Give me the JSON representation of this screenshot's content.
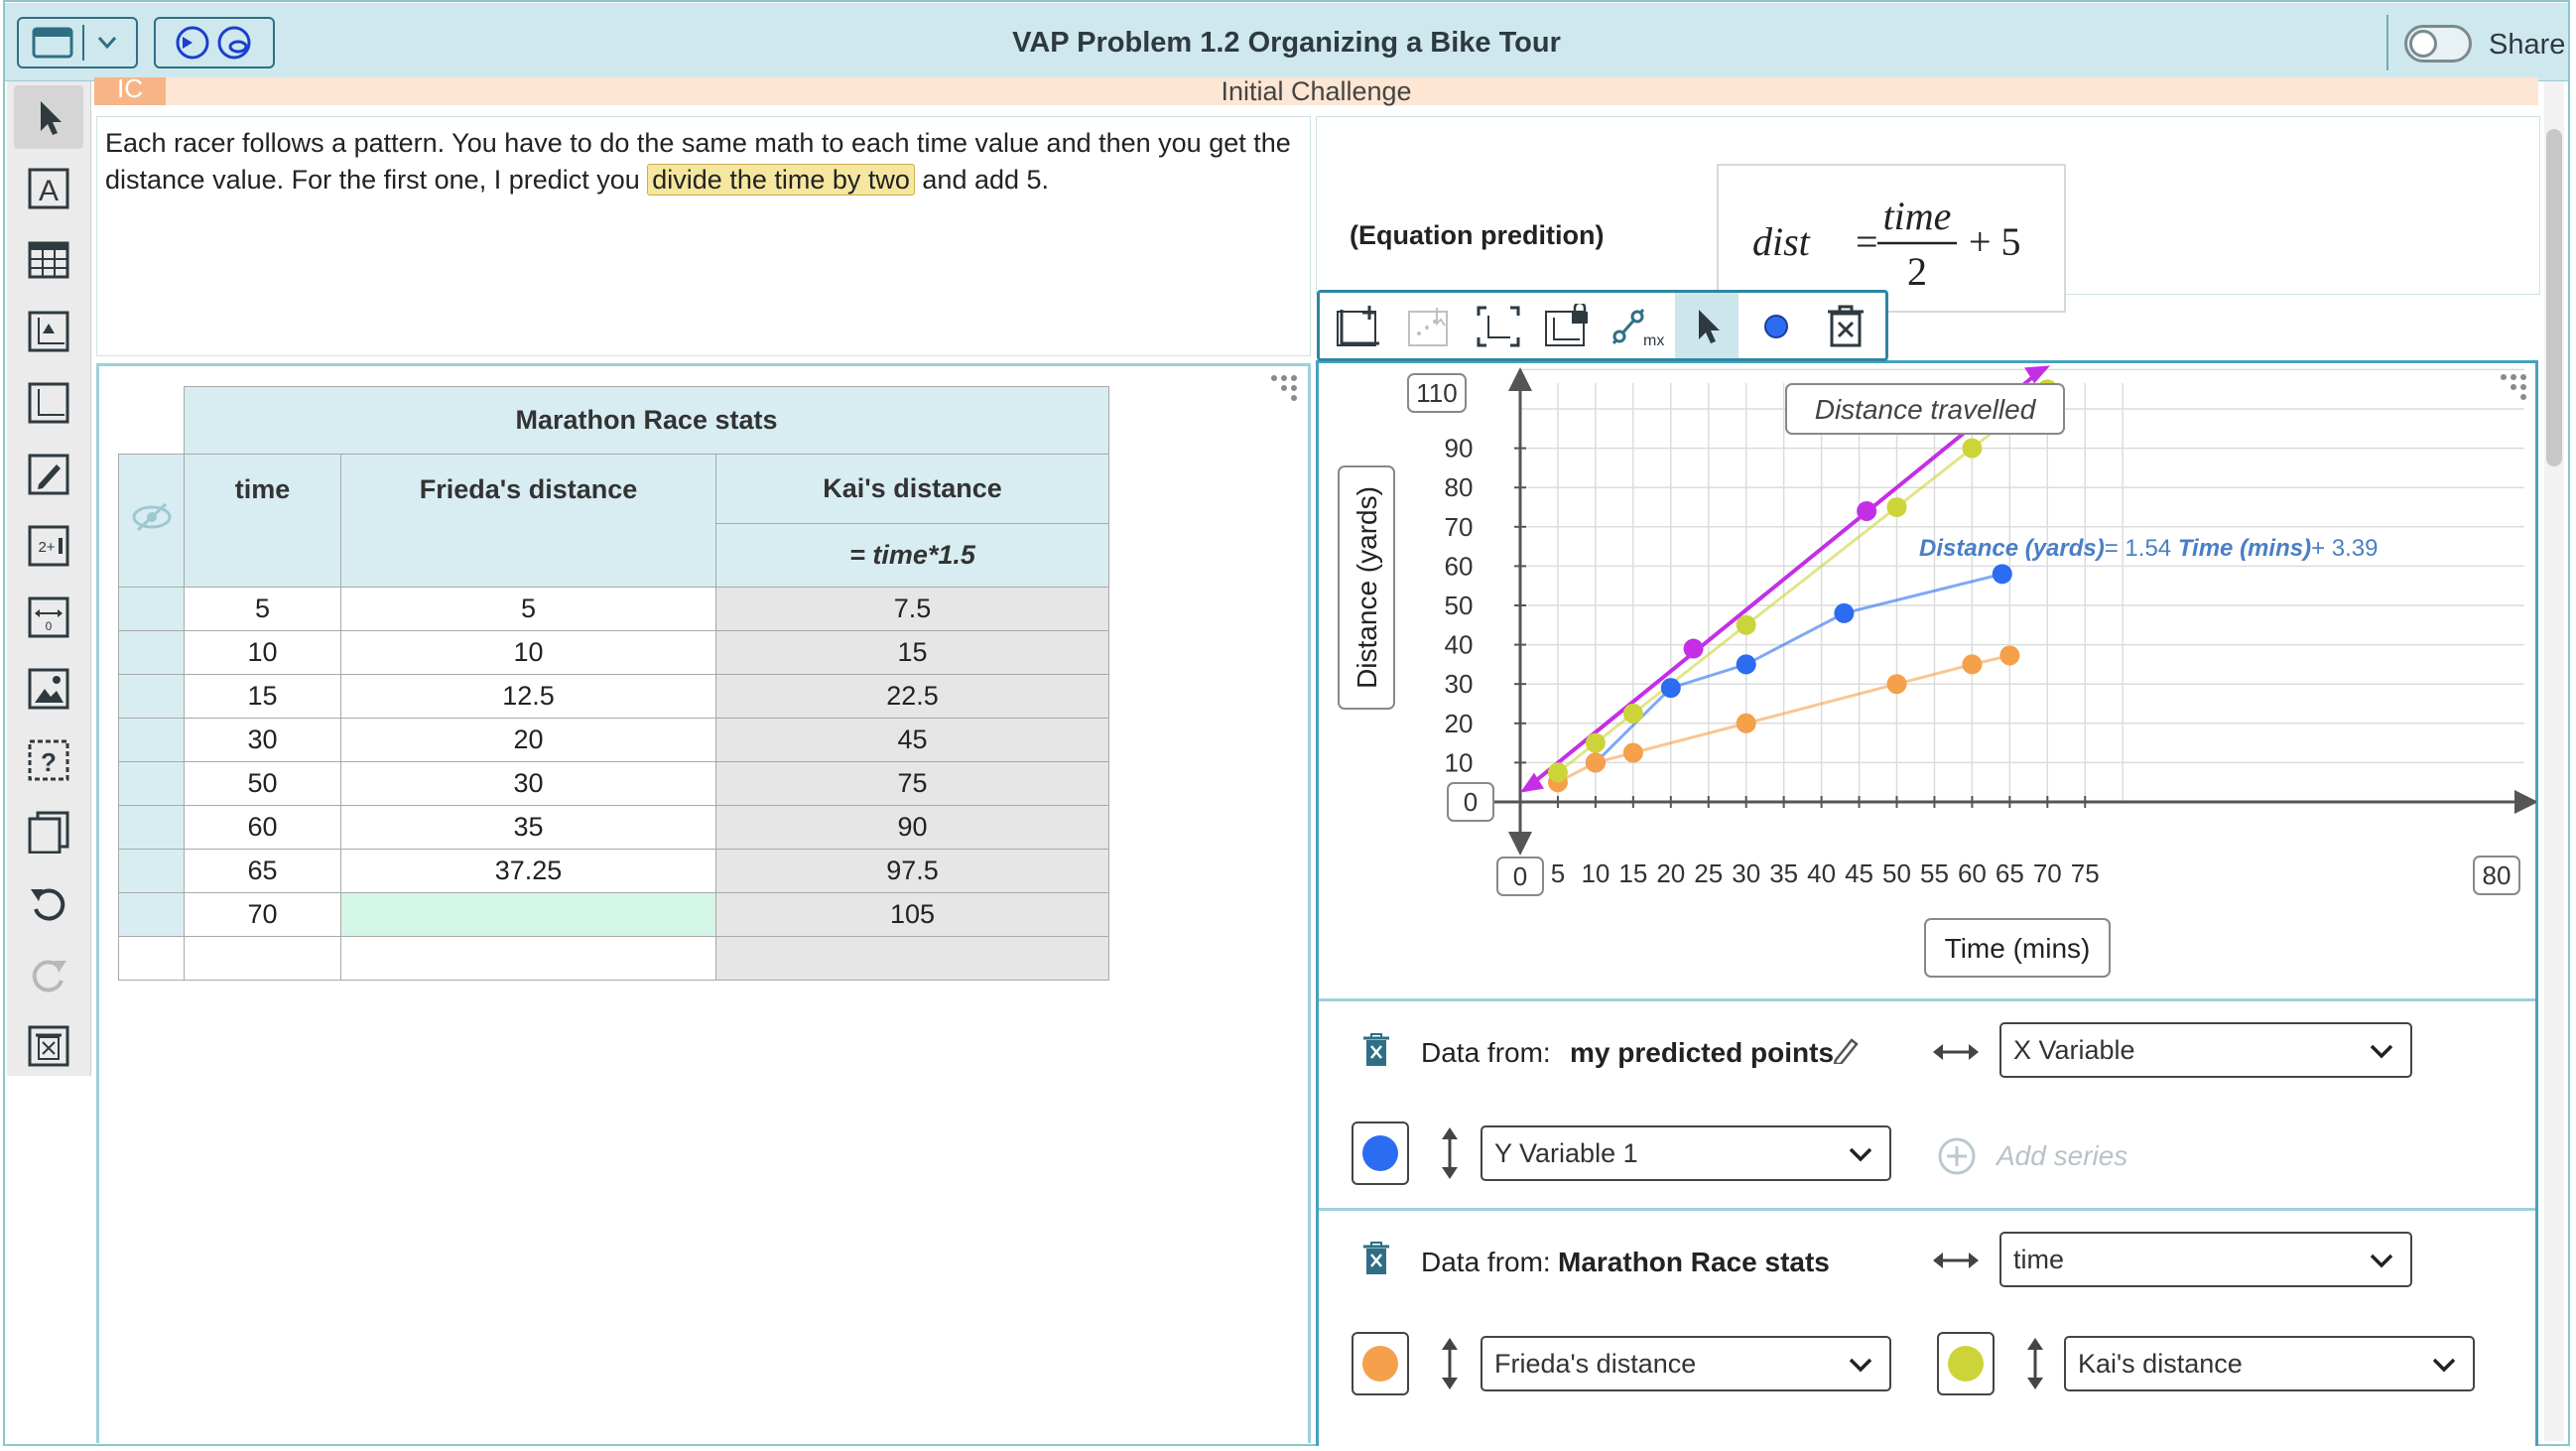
{
  "title": "VAP Problem 1.2 Organizing a Bike Tour",
  "share_label": "Share",
  "banner": {
    "tag": "IC",
    "text": "Initial Challenge"
  },
  "text_tile": {
    "before": "Each racer follows a pattern. You have to do the same math to each time value and then you get the distance value. For the first one, I predict you ",
    "highlight": "divide the time by two",
    "after": " and add 5."
  },
  "equation": {
    "label": "(Equation predition)",
    "lhs": "dist",
    "num": "time",
    "den": "2",
    "rhs": "+ 5"
  },
  "table": {
    "title": "Marathon Race stats",
    "headers": [
      "time",
      "Frieda's distance",
      "Kai's distance"
    ],
    "formula": "= time*1.5",
    "rows": [
      [
        "5",
        "5",
        "7.5"
      ],
      [
        "10",
        "10",
        "15"
      ],
      [
        "15",
        "12.5",
        "22.5"
      ],
      [
        "30",
        "20",
        "45"
      ],
      [
        "50",
        "30",
        "75"
      ],
      [
        "60",
        "35",
        "90"
      ],
      [
        "65",
        "37.25",
        "97.5"
      ],
      [
        "70",
        "",
        "105"
      ],
      [
        "",
        "",
        ""
      ]
    ]
  },
  "chart_data": {
    "type": "scatter",
    "title": "Distance travelled",
    "xlabel": "Time (mins)",
    "ylabel": "Distance (yards)",
    "xlim": [
      0,
      80
    ],
    "ylim": [
      0,
      110
    ],
    "x_ticks": [
      5,
      10,
      15,
      20,
      25,
      30,
      35,
      40,
      45,
      50,
      55,
      60,
      65,
      70,
      75
    ],
    "y_ticks": [
      10,
      20,
      30,
      40,
      50,
      60,
      70,
      80,
      90
    ],
    "x_min_label": "0",
    "x_max_label": "80",
    "y_min_label": "0",
    "y_max_label": "110",
    "regression_label": {
      "a": "Distance (yards)",
      "b": "= 1.54 ",
      "c": "Time (mins)",
      "d": "+ 3.39"
    },
    "series": [
      {
        "name": "my predicted points",
        "color": "#2b6cf0",
        "connect": true,
        "points": [
          [
            10,
            10
          ],
          [
            20,
            29
          ],
          [
            30,
            35
          ],
          [
            43,
            48
          ],
          [
            64,
            58
          ]
        ]
      },
      {
        "name": "Frieda's distance",
        "color": "#f5a04a",
        "connect": true,
        "points": [
          [
            5,
            5
          ],
          [
            10,
            10
          ],
          [
            15,
            12.5
          ],
          [
            30,
            20
          ],
          [
            50,
            30
          ],
          [
            60,
            35
          ],
          [
            65,
            37.25
          ]
        ]
      },
      {
        "name": "Kai's distance",
        "color": "#cdd43a",
        "connect": true,
        "points": [
          [
            5,
            7.5
          ],
          [
            10,
            15
          ],
          [
            15,
            22.5
          ],
          [
            30,
            45
          ],
          [
            50,
            75
          ],
          [
            60,
            90
          ],
          [
            65,
            97.5
          ],
          [
            70,
            105
          ]
        ]
      },
      {
        "name": "",
        "color": "#c42fe6",
        "connect": false,
        "points": [
          [
            23,
            39
          ],
          [
            46,
            74
          ]
        ]
      }
    ],
    "movable_line": {
      "color": "#c42fe6",
      "slope": 1.54,
      "intercept": 3.39,
      "from": [
        0,
        3.39
      ],
      "to": [
        68,
        108
      ]
    }
  },
  "data_panel_1": {
    "label": "Data from:",
    "source": "my predicted points",
    "x_select": "X Variable",
    "y_select": "Y Variable 1",
    "add_series": "Add series",
    "color": "#2b6cf0"
  },
  "data_panel_2": {
    "label": "Data from:",
    "source": "Marathon Race stats",
    "x_select": "time",
    "y_select_1": "Frieda's distance",
    "y_select_2": "Kai's distance",
    "color_1": "#f5a04a",
    "color_2": "#cdd43a"
  }
}
